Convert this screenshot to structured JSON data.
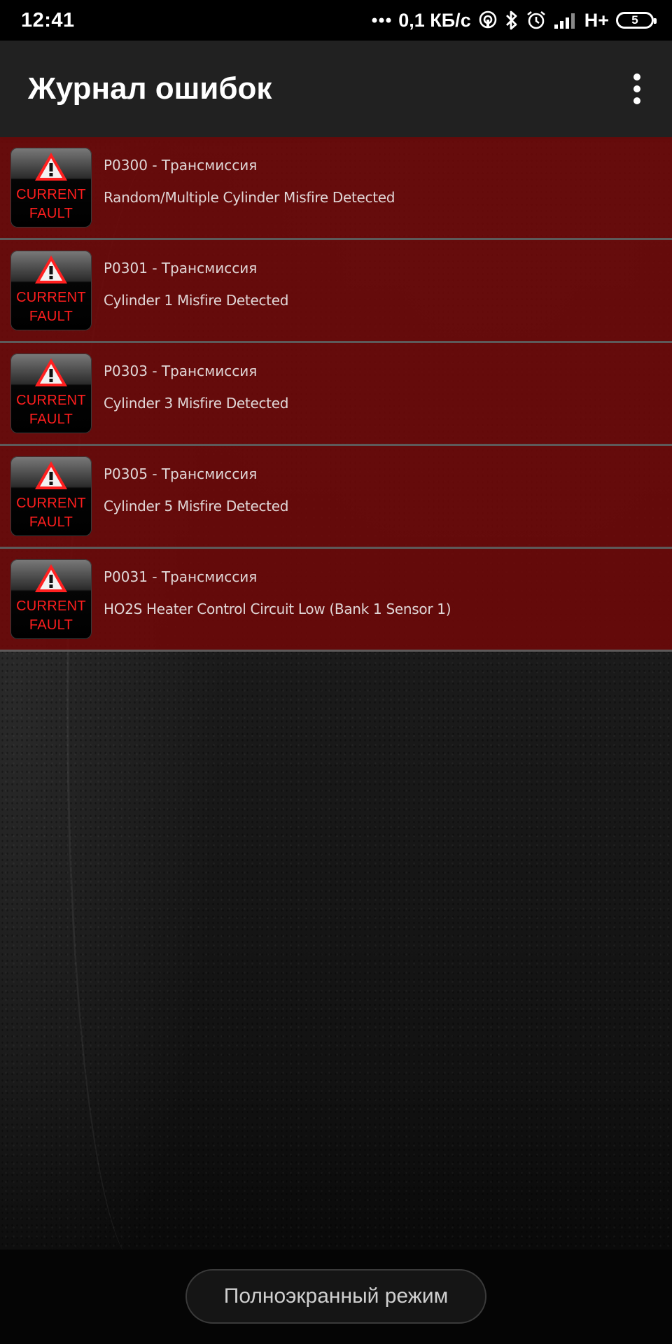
{
  "status_bar": {
    "time": "12:41",
    "network_speed": "0,1 КБ/с",
    "network_type": "H+",
    "battery_level": "5",
    "icons": [
      "dots-icon",
      "hotspot-icon",
      "bluetooth-icon",
      "alarm-icon",
      "signal-icon",
      "battery-icon"
    ]
  },
  "app_bar": {
    "title": "Журнал ошибок",
    "menu_icon": "more-vert-icon"
  },
  "faults": [
    {
      "code": "P0300 - Трансмиссия",
      "description": "Random/Multiple Cylinder Misfire Detected",
      "badge_line1": "CURRENT",
      "badge_line2": "FAULT"
    },
    {
      "code": "P0301 - Трансмиссия",
      "description": "Cylinder 1 Misfire Detected",
      "badge_line1": "CURRENT",
      "badge_line2": "FAULT"
    },
    {
      "code": "P0303 - Трансмиссия",
      "description": "Cylinder 3 Misfire Detected",
      "badge_line1": "CURRENT",
      "badge_line2": "FAULT"
    },
    {
      "code": "P0305 - Трансмиссия",
      "description": "Cylinder 5 Misfire Detected",
      "badge_line1": "CURRENT",
      "badge_line2": "FAULT"
    },
    {
      "code": "P0031 - Трансмиссия",
      "description": "HO2S Heater Control Circuit Low (Bank 1 Sensor 1)",
      "badge_line1": "CURRENT",
      "badge_line2": "FAULT"
    }
  ],
  "bottom": {
    "fullscreen_label": "Полноэкранный режим"
  },
  "colors": {
    "fault_row": "#6e0808",
    "badge_text": "#ff1e1e",
    "app_bar": "#212121"
  }
}
